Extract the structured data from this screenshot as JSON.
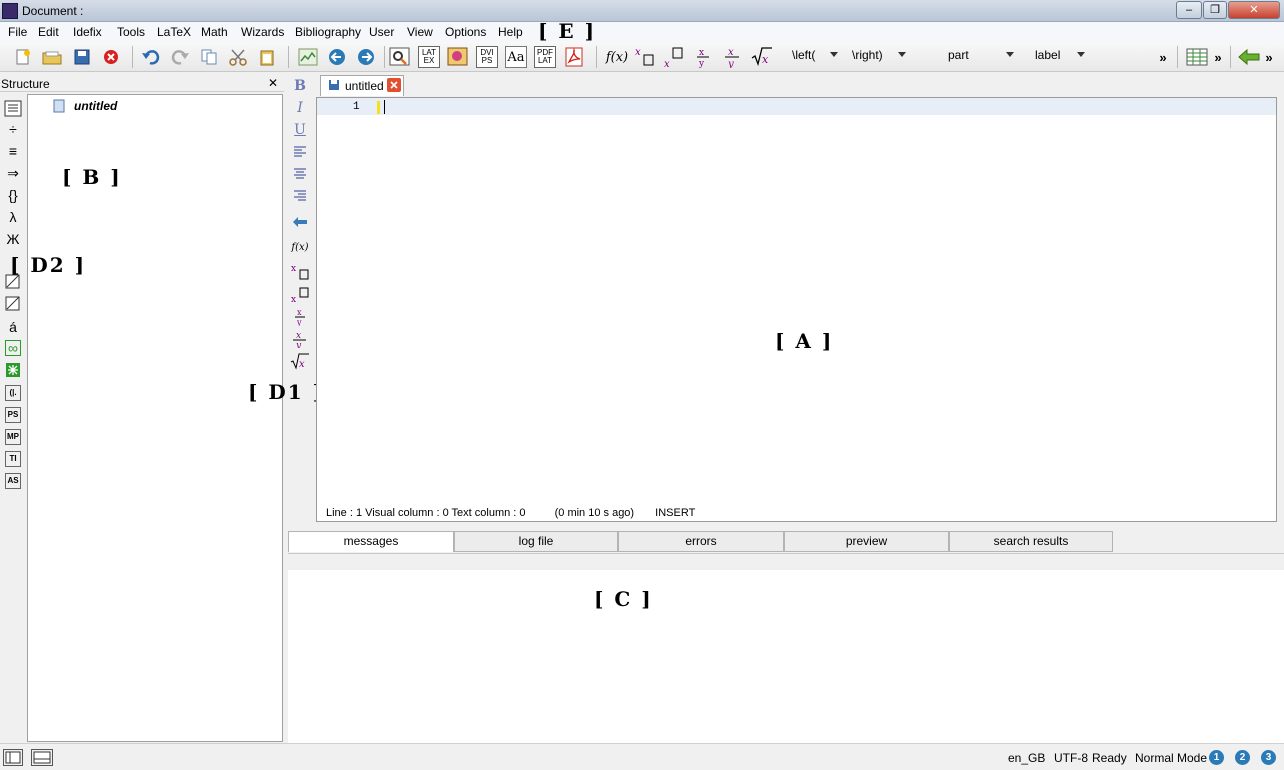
{
  "window": {
    "title": "Document :",
    "min": "–",
    "max": "❐",
    "close": "✕"
  },
  "menu": [
    "File",
    "Edit",
    "Idefix",
    "Tools",
    "LaTeX",
    "Math",
    "Wizards",
    "Bibliography",
    "User",
    "View",
    "Options",
    "Help"
  ],
  "markers": {
    "E": "[ E ]",
    "B": "[ B ]",
    "D2": "[ D2 ]",
    "D1": "[ D1 ]",
    "A": "[ A ]",
    "C": "[ C ]"
  },
  "toolbar": {
    "btn_latex": "LAT EX",
    "btn_dvips": "DVI PS",
    "btn_font": "Aa",
    "btn_pdflat": "PDF LAT",
    "left_combo": "\\left(",
    "right_combo": "\\right)",
    "part_combo": "part",
    "label_combo": "label",
    "overflow1": "»",
    "overflow2": "»",
    "overflow3": "»"
  },
  "structure": {
    "title": "Structure",
    "close": "✕",
    "root_item": "untitled"
  },
  "sidebar_icons": {
    "minus_div": "÷",
    "equiv": "≡",
    "arrow": "⇒",
    "braces": "{}",
    "lambda": "λ",
    "cyrillic": "Ж",
    "accent": "á",
    "infinity": "∞",
    "ps": "PS",
    "mp": "MP",
    "ti": "TI",
    "as": "AS",
    "paren": "(|."
  },
  "format_icons": {
    "bold": "B",
    "italic": "I",
    "underline": "U",
    "fx": "f(x)"
  },
  "editor": {
    "tab_label": "untitled",
    "line_number": "1",
    "status": {
      "line": "Line : 1 Visual column : 0 Text column : 0",
      "ago": "(0 min 10 s ago)",
      "mode": "INSERT"
    }
  },
  "bottom_tabs": [
    "messages",
    "log file",
    "errors",
    "preview",
    "search results"
  ],
  "statusbar": {
    "lang": "en_GB",
    "encoding": "UTF-8",
    "state": "Ready",
    "mode": "Normal Mode",
    "n1": "1",
    "n2": "2",
    "n3": "3"
  }
}
